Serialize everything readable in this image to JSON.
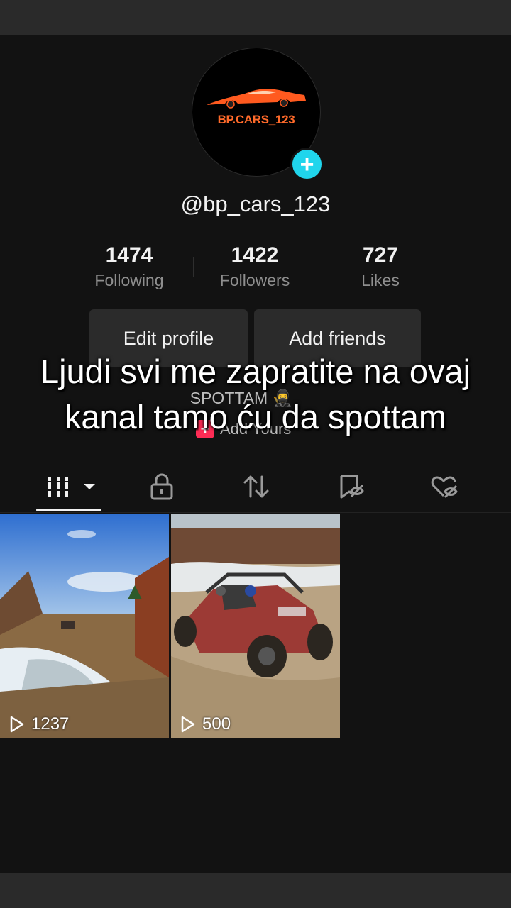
{
  "profile": {
    "avatar_text": "BP.CARS_123",
    "username": "@bp_cars_123",
    "add_icon": "plus-icon"
  },
  "stats": [
    {
      "value": "1474",
      "label": "Following"
    },
    {
      "value": "1422",
      "label": "Followers"
    },
    {
      "value": "727",
      "label": "Likes"
    }
  ],
  "actions": {
    "edit_profile": "Edit profile",
    "add_friends": "Add friends"
  },
  "bio": {
    "text": "SPOTTAM 🥷",
    "add_yours_label": "Add Yours"
  },
  "caption": "Ljudi svi me zapratite na ovaj kanal tamo ću da spottam",
  "tabs": [
    {
      "icon": "grid-icon",
      "active": true
    },
    {
      "icon": "lock-icon",
      "active": false
    },
    {
      "icon": "repost-icon",
      "active": false
    },
    {
      "icon": "bookmark-hidden-icon",
      "active": false
    },
    {
      "icon": "heart-hidden-icon",
      "active": false
    }
  ],
  "videos": [
    {
      "views": "1237",
      "scene": "snowy forest trail with buggy in distance"
    },
    {
      "views": "500",
      "scene": "red off-road side-by-side buggy"
    }
  ],
  "colors": {
    "accent_cyan": "#20d5ec",
    "accent_red": "#fe2c55",
    "brand_orange": "#ff6a2a",
    "background": "#121212"
  }
}
